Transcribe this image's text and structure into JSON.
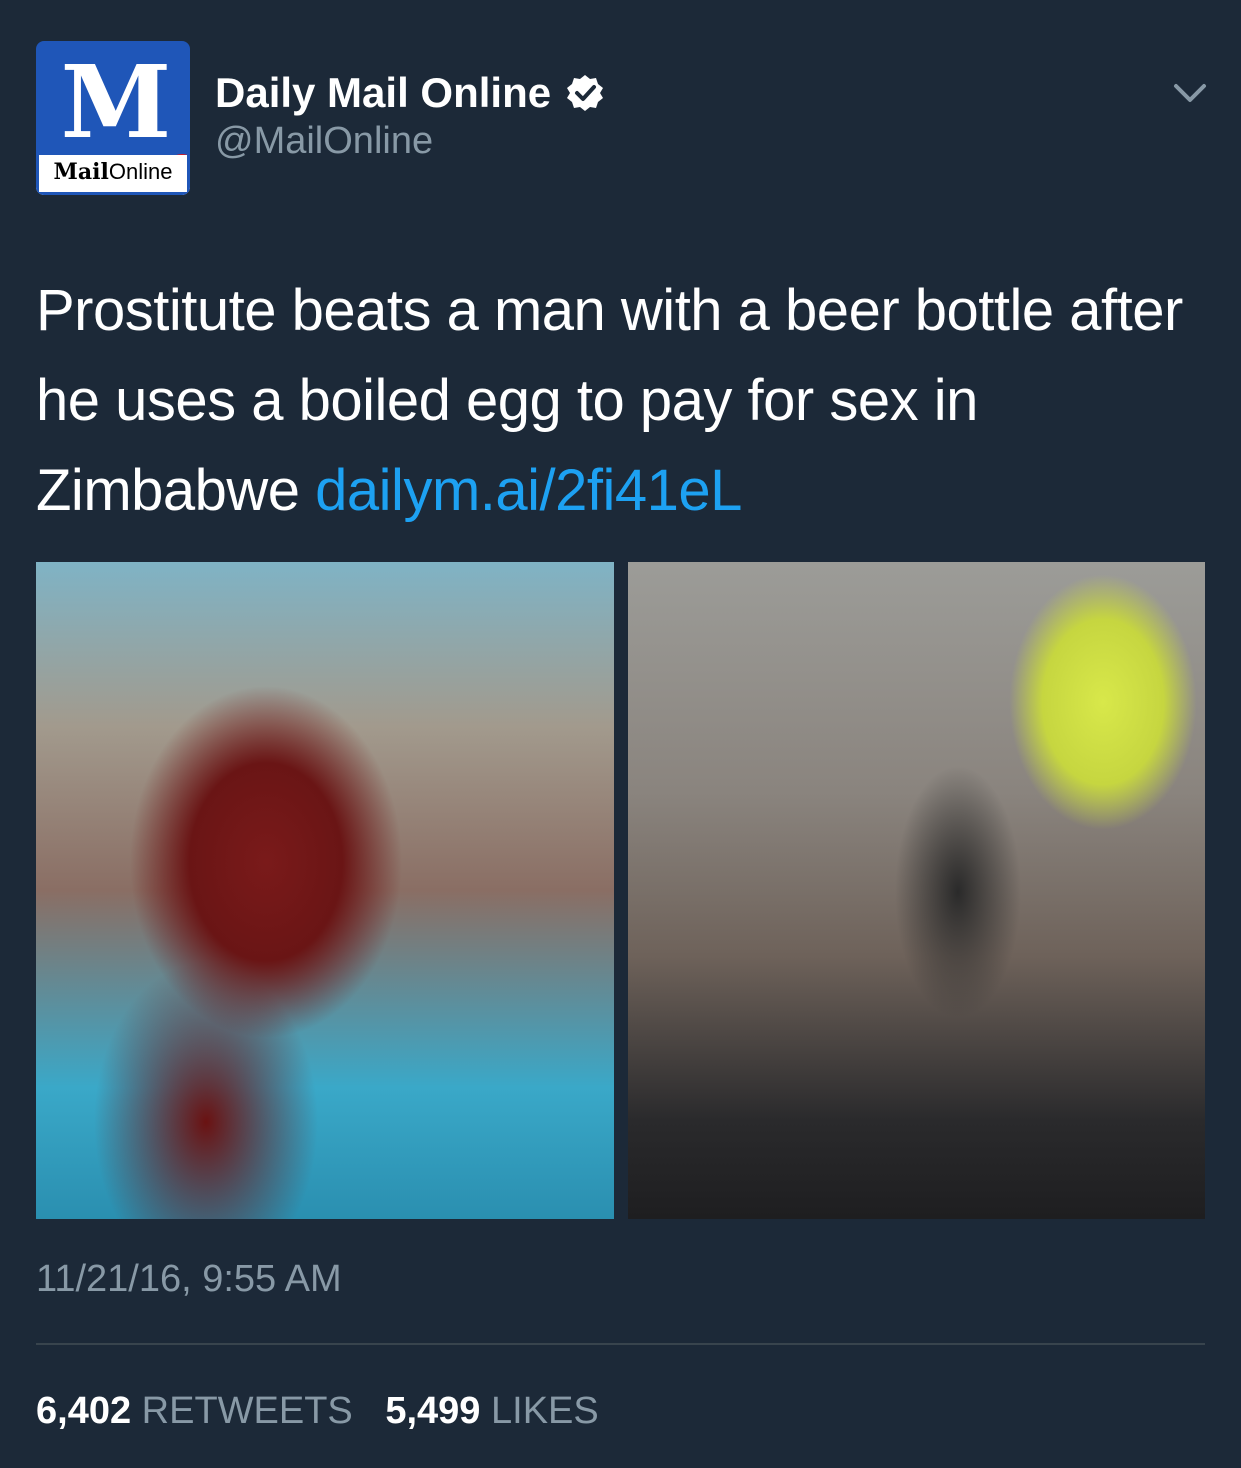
{
  "account": {
    "name": "Daily Mail Online",
    "handle": "@MailOnline",
    "avatar_monogram": "M",
    "avatar_brand_bold": "Mail",
    "avatar_brand_light": "Online",
    "verified": true
  },
  "tweet": {
    "text": "Prostitute beats a man with a beer bottle after he uses a boiled egg to pay for sex in Zimbabwe ",
    "link": "dailym.ai/2fi41eL",
    "timestamp": "11/21/16, 9:55 AM"
  },
  "stats": {
    "retweets_count": "6,402",
    "retweets_label": "RETWEETS",
    "likes_count": "5,499",
    "likes_label": "LIKES"
  },
  "icons": {
    "verified": "verified-badge-icon",
    "menu": "chevron-down-icon"
  },
  "colors": {
    "background": "#1c2938",
    "link": "#1da1f2",
    "secondary_text": "#8899a6",
    "divider": "#38444d"
  }
}
